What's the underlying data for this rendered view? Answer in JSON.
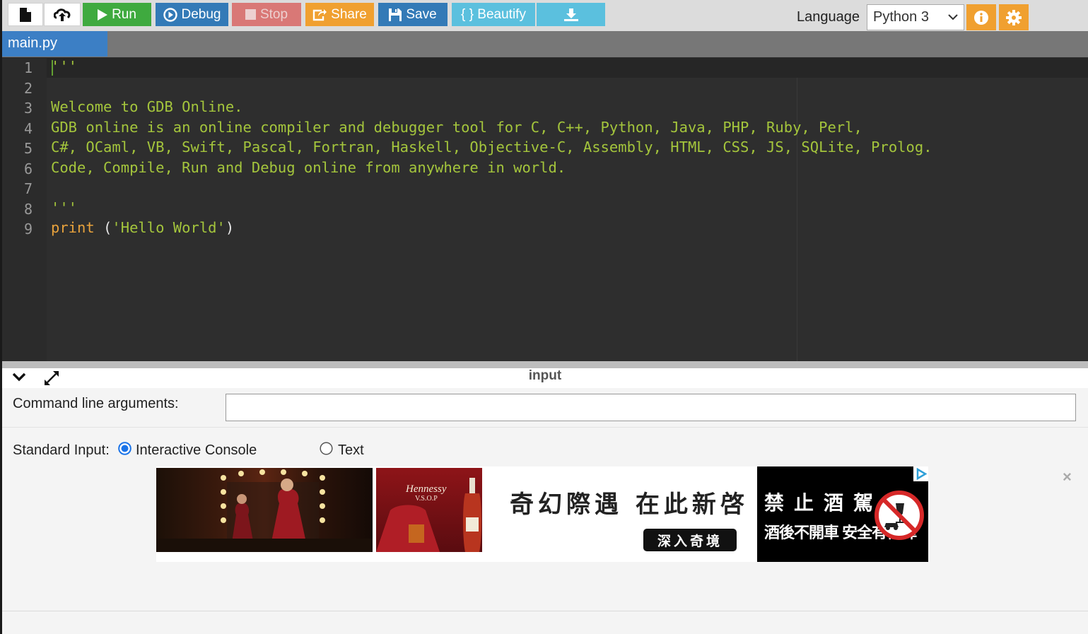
{
  "toolbar": {
    "new_file_icon": "new-file-icon",
    "upload_icon": "upload-icon",
    "run_label": "Run",
    "debug_label": "Debug",
    "stop_label": "Stop",
    "share_label": "Share",
    "save_label": "Save",
    "beautify_label": "{ } Beautify",
    "download_icon": "download-icon",
    "language_label": "Language",
    "language_value": "Python 3",
    "info_icon": "info-icon",
    "settings_icon": "gear-icon"
  },
  "colors": {
    "run": "#3faa3f",
    "debug": "#337ab7",
    "stop": "#d9534f",
    "share": "#f0a030",
    "save": "#337ab7",
    "beautify": "#5bc0de",
    "editor_bg": "#2e2e2e",
    "comment": "#a4c53c",
    "keyword": "#e8a23c"
  },
  "tabs": [
    {
      "label": "main.py",
      "active": true
    }
  ],
  "editor": {
    "line_numbers": [
      "1",
      "2",
      "3",
      "4",
      "5",
      "6",
      "7",
      "8",
      "9"
    ],
    "lines": [
      "'''",
      "",
      "Welcome to GDB Online.",
      "GDB online is an online compiler and debugger tool for C, C++, Python, Java, PHP, Ruby, Perl,",
      "C#, OCaml, VB, Swift, Pascal, Fortran, Haskell, Objective-C, Assembly, HTML, CSS, JS, SQLite, Prolog.",
      "Code, Compile, Run and Debug online from anywhere in world.",
      "",
      "'''",
      ""
    ],
    "print_keyword": "print",
    "print_open": " (",
    "print_string": "'Hello World'",
    "print_close": ")"
  },
  "input_panel": {
    "title": "input",
    "args_label": "Command line arguments:",
    "args_value": "",
    "stdin_label": "Standard Input:",
    "option_console": "Interactive Console",
    "option_text": "Text",
    "selected": "Interactive Console"
  },
  "ad": {
    "brand": "Hennessy",
    "brand_sub": "V.S.O.P",
    "headline": "奇幻際遇 在此新啓",
    "cta": "深入奇境",
    "warning_line1": "禁止酒駕",
    "warning_line2": "酒後不開車 安全有保障",
    "close_label": "×"
  }
}
